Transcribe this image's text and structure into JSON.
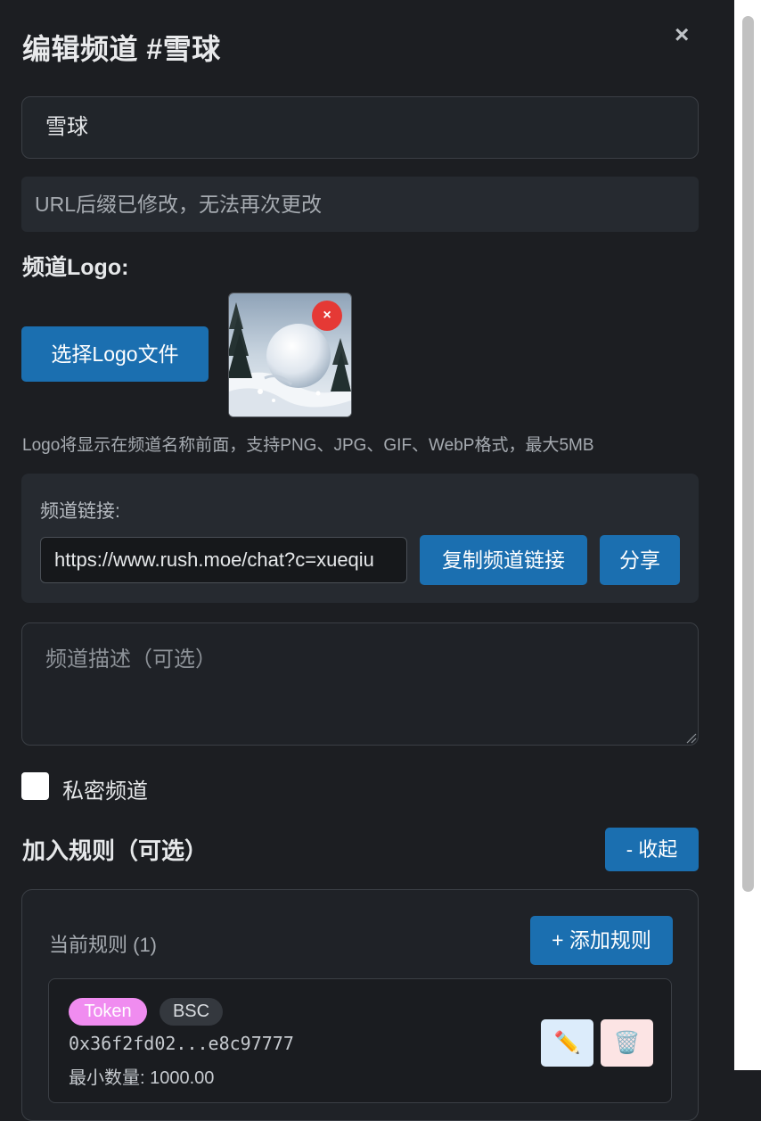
{
  "dialog": {
    "title": "编辑频道 #雪球",
    "close_glyph": "×"
  },
  "form": {
    "channel_name": "雪球",
    "url_note": "URL后缀已修改，无法再次更改",
    "logo_label": "频道Logo:",
    "choose_logo_label": "选择Logo文件",
    "logo_remove_glyph": "×",
    "logo_hint": "Logo将显示在频道名称前面，支持PNG、JPG、GIF、WebP格式，最大5MB",
    "channel_link_label": "频道链接:",
    "channel_link_value": "https://www.rush.moe/chat?c=xueqiu",
    "copy_link_label": "复制频道链接",
    "share_label": "分享",
    "description_placeholder": "频道描述（可选）",
    "private_checked": false,
    "private_label": "私密频道"
  },
  "rules": {
    "title": "加入规则（可选）",
    "collapse_label": "- 收起",
    "current_label": "当前规则 (1)",
    "add_label": "+ 添加规则",
    "items": [
      {
        "type_tag": "Token",
        "chain_tag": "BSC",
        "address": "0x36f2fd02...e8c97777",
        "min_amount": "最小数量: 1000.00",
        "edit_icon": "✏️",
        "delete_icon": "🗑️"
      }
    ]
  },
  "colors": {
    "background": "#1c1e22",
    "accent_blue": "#1b6fb0",
    "token_tag": "#f08cf0",
    "remove_red": "#e53935"
  }
}
